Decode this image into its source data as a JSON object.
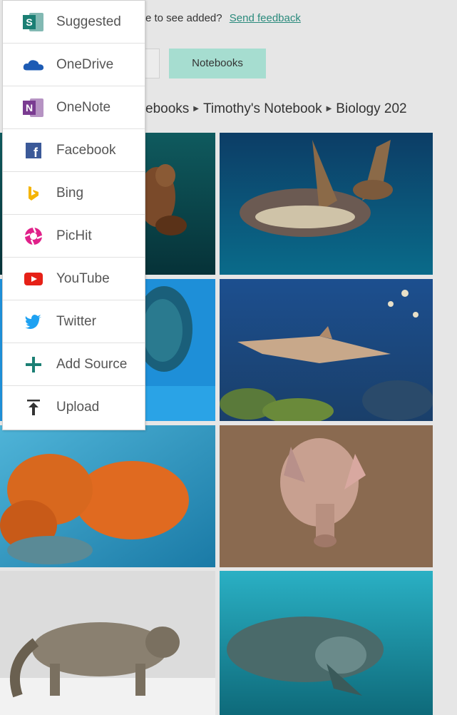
{
  "header": {
    "prompt_text": "e to see added?",
    "feedback_label": "Send feedback"
  },
  "toolbar": {
    "notebooks_label": "Notebooks"
  },
  "breadcrumb": {
    "items": [
      "ebooks",
      "Timothy's Notebook",
      "Biology 202"
    ]
  },
  "source_menu": {
    "items": [
      {
        "label": "Suggested",
        "icon": "sharepoint-icon",
        "color": "#1b7f74"
      },
      {
        "label": "OneDrive",
        "icon": "onedrive-icon",
        "color": "#1d5bb4"
      },
      {
        "label": "OneNote",
        "icon": "onenote-icon",
        "color": "#7a3b91"
      },
      {
        "label": "Facebook",
        "icon": "facebook-icon",
        "color": "#3b5998"
      },
      {
        "label": "Bing",
        "icon": "bing-icon",
        "color": "#f5b400"
      },
      {
        "label": "PicHit",
        "icon": "pichit-icon",
        "color": "#e0218a"
      },
      {
        "label": "YouTube",
        "icon": "youtube-icon",
        "color": "#e62117"
      },
      {
        "label": "Twitter",
        "icon": "twitter-icon",
        "color": "#1da1f2"
      },
      {
        "label": "Add Source",
        "icon": "plus-icon",
        "color": "#1b7f74"
      },
      {
        "label": "Upload",
        "icon": "upload-icon",
        "color": "#333333"
      }
    ]
  },
  "gallery": {
    "images": [
      {
        "subject": "sea-lion"
      },
      {
        "subject": "sea-turtle"
      },
      {
        "subject": "coral-diver"
      },
      {
        "subject": "shark-reef"
      },
      {
        "subject": "octopus"
      },
      {
        "subject": "aardvark"
      },
      {
        "subject": "snow-leopard"
      },
      {
        "subject": "manatee"
      }
    ]
  },
  "colors": {
    "accent": "#2a8a7c",
    "notebooks_button": "#a6ddd0",
    "background": "#e6e6e6"
  }
}
